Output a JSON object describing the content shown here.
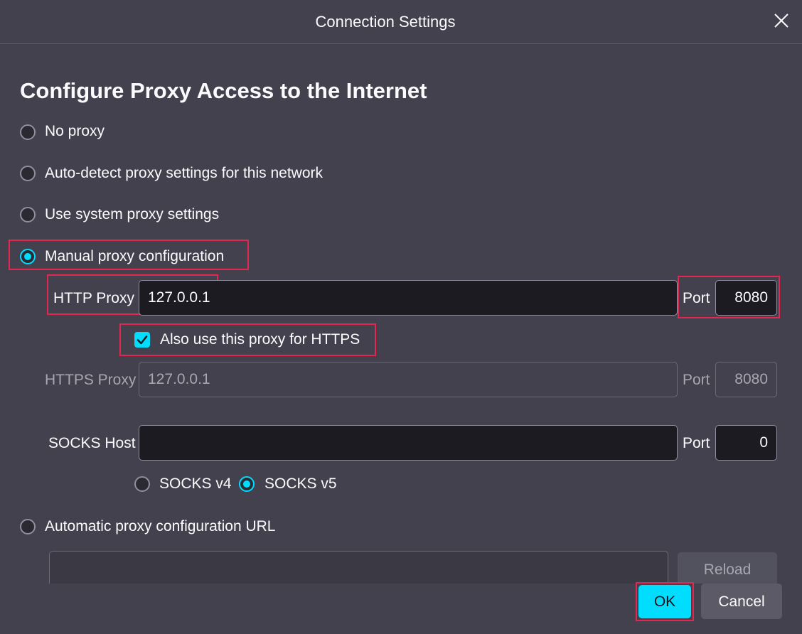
{
  "dialog": {
    "title": "Connection Settings",
    "close_icon": "close-icon"
  },
  "heading": "Configure Proxy Access to the Internet",
  "options": {
    "no_proxy": "No proxy",
    "auto_detect": "Auto-detect proxy settings for this network",
    "system": "Use system proxy settings",
    "manual": "Manual proxy configuration",
    "auto_url": "Automatic proxy configuration URL",
    "selected": "manual"
  },
  "http": {
    "label": "HTTP Proxy",
    "value": "127.0.0.1",
    "port_label": "Port",
    "port_value": "8080"
  },
  "also_https": {
    "label": "Also use this proxy for HTTPS",
    "checked": true
  },
  "https": {
    "label": "HTTPS Proxy",
    "placeholder": "127.0.0.1",
    "port_label": "Port",
    "port_placeholder": "8080"
  },
  "socks": {
    "label": "SOCKS Host",
    "value": "",
    "port_label": "Port",
    "port_value": "0",
    "v4_label": "SOCKS v4",
    "v5_label": "SOCKS v5",
    "selected": "v5"
  },
  "pac": {
    "url_value": "",
    "reload_label": "Reload"
  },
  "buttons": {
    "ok": "OK",
    "cancel": "Cancel"
  },
  "colors": {
    "accent": "#00ddff",
    "highlight": "#e22850",
    "background": "#42414d"
  }
}
